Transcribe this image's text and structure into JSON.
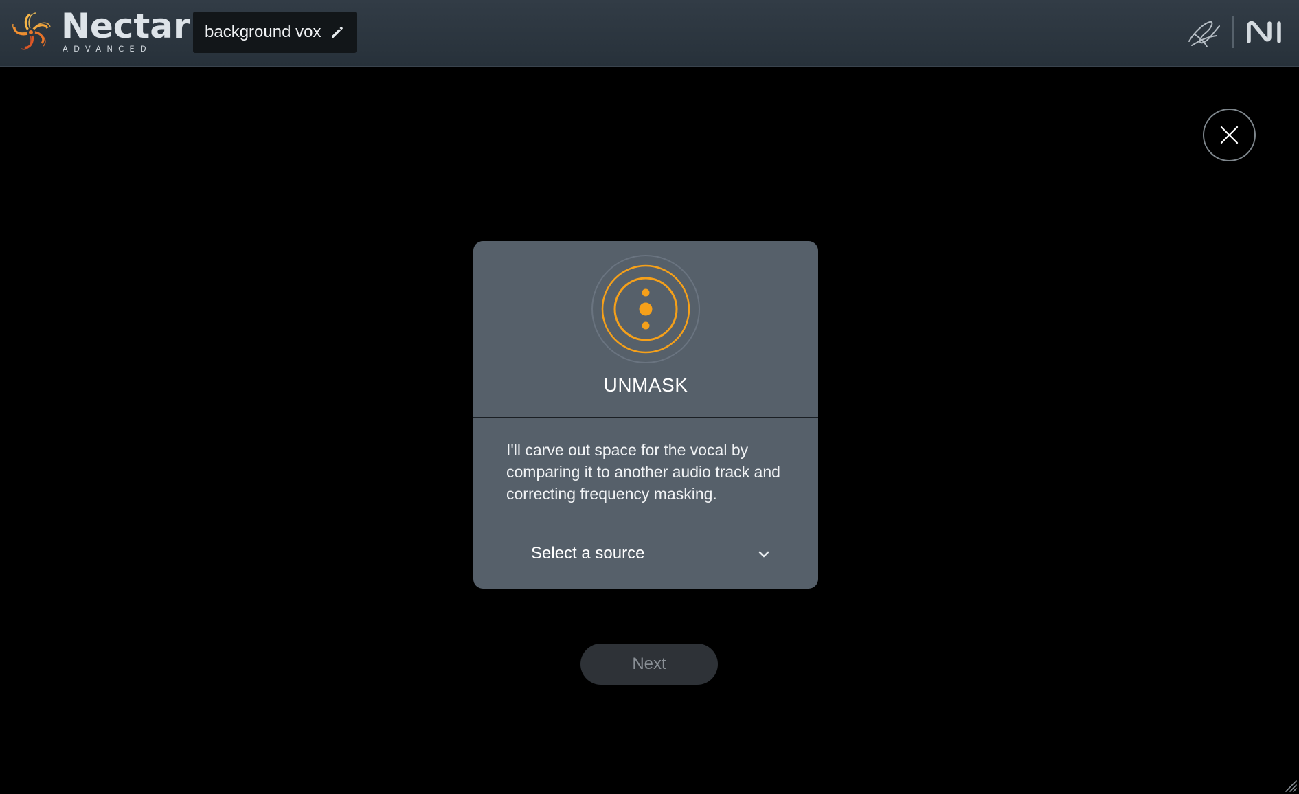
{
  "header": {
    "brand_name": "Nectar",
    "brand_sub": "ADVANCED",
    "preset_name": "background vox",
    "icons": [
      "nectar-logo-icon",
      "pencil-icon",
      "signature-icon",
      "ni-logo-icon"
    ]
  },
  "dialog": {
    "close_icon": "close-icon",
    "title": "UNMASK",
    "description": "I'll carve out space for the vocal by comparing it to another audio track and correcting frequency masking.",
    "source_select": {
      "value": "Select a source",
      "icon": "chevron-down-icon"
    },
    "next_label": "Next"
  },
  "colors": {
    "background": "#000000",
    "header": "#2d3741",
    "card": "#56606a",
    "accent": "#f5a01a",
    "next_button": "#2e3237",
    "next_text": "#8a9096"
  }
}
